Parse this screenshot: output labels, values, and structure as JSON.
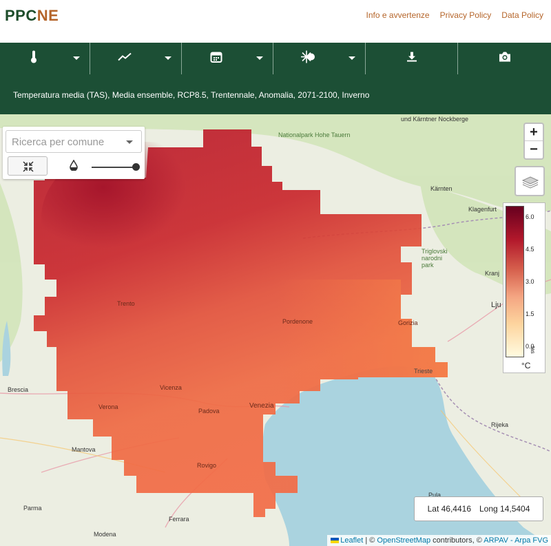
{
  "header": {
    "logo_part1": "PPC",
    "logo_part2": "NE",
    "links": [
      "Info e avvertenze",
      "Privacy Policy",
      "Data Policy"
    ]
  },
  "toolbar": {
    "buttons": [
      {
        "icon": "thermometer-icon",
        "dropdown": true
      },
      {
        "icon": "trend-chart-icon",
        "dropdown": true
      },
      {
        "icon": "calendar-icon",
        "dropdown": true
      },
      {
        "icon": "season-icon",
        "dropdown": true
      },
      {
        "icon": "download-icon",
        "dropdown": false
      },
      {
        "icon": "camera-icon",
        "dropdown": false
      }
    ],
    "background": "#1c4f35"
  },
  "title": "Temperatura media (TAS), Media ensemble, RCP8.5, Trentennale, Anomalia, 2071-2100, Inverno",
  "search": {
    "placeholder": "Ricerca per comune",
    "opacity_value": 1.0
  },
  "zoom": {
    "in_label": "+",
    "out_label": "−"
  },
  "legend": {
    "ticks": [
      "6.0",
      "4.5",
      "3.0",
      "1.5",
      "0.0"
    ],
    "unit": "°C",
    "variable": "tas",
    "colors": [
      "#67001f",
      "#b2182b",
      "#d6604d",
      "#f4a582",
      "#fdd49e",
      "#fffbe0"
    ]
  },
  "coordinates": {
    "lat_label": "Lat 46,4416",
    "long_label": "Long 14,5404"
  },
  "attribution": {
    "leaflet": "Leaflet",
    "sep1": " | © ",
    "osm": "OpenStreetMap",
    "contributors": " contributors, © ",
    "arpav": "ARPAV - Arpa FVG"
  },
  "map_labels": [
    "und Kärntner Nockberge",
    "Nationalpark Hohe Tauern",
    "Kärnten",
    "Klagenfurt",
    "Triglovski narodni park",
    "Kranj",
    "Lju",
    "Brescia",
    "Mantova",
    "Modena",
    "Parma",
    "Ferrara",
    "Trieste",
    "Rijeka",
    "Pula",
    "Venezia",
    "Gorizia",
    "Pordenone",
    "Vicenza",
    "Verona",
    "Rovigo",
    "Trento",
    "Padova"
  ]
}
